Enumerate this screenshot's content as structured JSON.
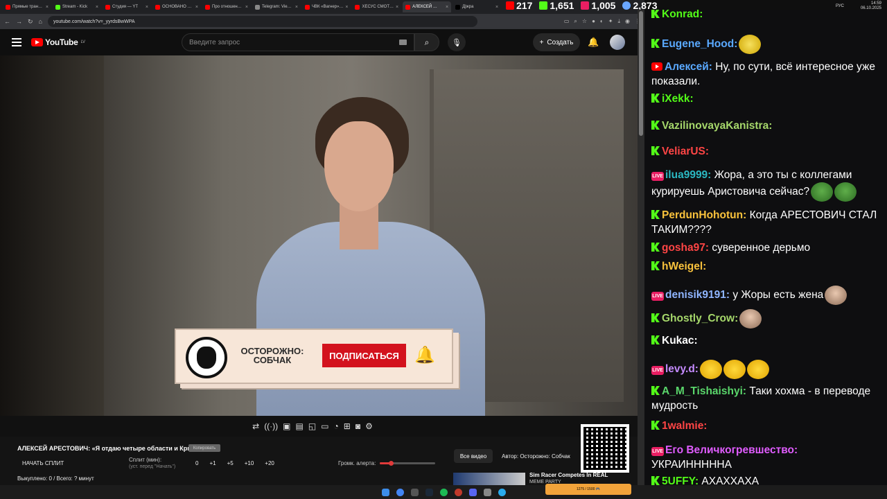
{
  "browser": {
    "tabs": [
      {
        "label": "Прямые тран…",
        "color": "#ff0000",
        "active": false
      },
      {
        "label": "Stream - Kick",
        "color": "#53fc18",
        "active": false
      },
      {
        "label": "Студия — YT",
        "color": "#ff0000",
        "active": false
      },
      {
        "label": "ОСНОВАНО …",
        "color": "#ff0000",
        "active": false
      },
      {
        "label": "Про отношен…",
        "color": "#ff0000",
        "active": false
      },
      {
        "label": "Telegram: Vie…",
        "color": "#888888",
        "active": false
      },
      {
        "label": "ЧВК «Вагнер»…",
        "color": "#ff0000",
        "active": false
      },
      {
        "label": "ХЕСУС СМОТ…",
        "color": "#ff0000",
        "active": false
      },
      {
        "label": "АЛЕКСЕЙ …",
        "color": "#ff0000",
        "active": true
      },
      {
        "label": "Д|жра",
        "color": "#000000",
        "active": false
      }
    ],
    "url": "youtube.com/watch?v=_yyrdsBwWPA"
  },
  "stream_stats": {
    "kick": "217",
    "kick_extra": "1,651",
    "live": "1,005",
    "viewers": "2,873"
  },
  "youtube": {
    "logo_text": "YouTube",
    "region": "LV",
    "search_placeholder": "Введите запрос",
    "create_label": "Создать"
  },
  "overlay": {
    "channel": "ОСТОРОЖНО: СОБЧАК",
    "subscribe": "ПОДПИСАТЬСЯ"
  },
  "tool": {
    "video_title": "АЛЕКСЕЙ АРЕСТОВИЧ: «Я отдаю четыре области и Крым»",
    "title_tag": "Копировать",
    "start_split": "НАЧАТЬ СПЛИТ",
    "split_label": "Сплит (мин):",
    "split_hint": "(уст. перед \"Начать\")",
    "split_values": [
      "0",
      "+1",
      "+5",
      "+10",
      "+20"
    ],
    "volume_label": "Громк. алерта:",
    "volume_level": 0.2,
    "status": "Выкуплено: 0 / Всего: ? минут",
    "all_videos": "Все видео",
    "author": "Автор: Осторожно: Собчак",
    "rec_title": "Sim Racer Competes In REAL",
    "rec_sub": "MEME PARTY"
  },
  "taskbar": {
    "lang": "РУС",
    "time": "14:59",
    "date": "06.10.2025",
    "progress": "1275 / 1500 🎮"
  },
  "chat": [
    {
      "platform": "kick",
      "name": "Konrad:",
      "color": "#53fc18",
      "text": "",
      "emotes": [
        "face"
      ]
    },
    {
      "platform": "kick",
      "name": "Eugene_Hood:",
      "color": "#5aa9ff",
      "text": "",
      "emotes": [
        "duck"
      ]
    },
    {
      "platform": "youtube",
      "name": "Алексей:",
      "color": "#5aa9ff",
      "text": "Ну, по сути, всё интересное уже показали.",
      "emotes": []
    },
    {
      "platform": "kick",
      "name": "iXekk:",
      "color": "#53fc18",
      "text": "",
      "emotes": [
        "face"
      ]
    },
    {
      "platform": "kick",
      "name": "VazilinovayaKanistra:",
      "color": "#a6d86b",
      "text": "",
      "emotes": [
        "face"
      ]
    },
    {
      "platform": "kick",
      "name": "VeliarUS:",
      "color": "#ff4545",
      "text": "",
      "emotes": [
        "face"
      ]
    },
    {
      "platform": "live",
      "name": "ilua9999:",
      "color": "#2bb8c2",
      "text": "Жора, а это ты с коллегами курируешь Аристовича сейчас?",
      "emotes": [
        "pepe",
        "pepe"
      ]
    },
    {
      "platform": "kick",
      "name": "PerdunHohotun:",
      "color": "#f9c23c",
      "text": "Когда АРЕСТОВИЧ СТАЛ ТАКИМ????",
      "emotes": []
    },
    {
      "platform": "kick",
      "name": "gosha97:",
      "color": "#ff4545",
      "text": "суверенное дерьмо",
      "emotes": []
    },
    {
      "platform": "kick",
      "name": "hWeigel:",
      "color": "#f9c23c",
      "text": "",
      "emotes": [
        "face"
      ]
    },
    {
      "platform": "live",
      "name": "denisik9191:",
      "color": "#8fb5ff",
      "text": "у Жоры есть жена",
      "emotes": [
        "bald"
      ]
    },
    {
      "platform": "kick",
      "name": "Ghostly_Crow:",
      "color": "#a6d86b",
      "text": "",
      "emotes": [
        "bald"
      ]
    },
    {
      "platform": "kick",
      "name": "Kukac:",
      "color": "#ffffff",
      "text": "",
      "emotes": [
        "face",
        "face",
        "face"
      ]
    },
    {
      "platform": "live",
      "name": "levy.d:",
      "color": "#c58bff",
      "text": "",
      "emotes": [
        "lol",
        "lol",
        "lol"
      ]
    },
    {
      "platform": "kick",
      "name": "A_M_Tishaishyi:",
      "color": "#5ad66b",
      "text": "Таки хохма - в переводе мудрость",
      "emotes": []
    },
    {
      "platform": "kick",
      "name": "1walmie:",
      "color": "#ff4545",
      "text": "",
      "emotes": [
        "face"
      ]
    },
    {
      "platform": "live",
      "name": "Его Величкогревшество:",
      "color": "#e05cff",
      "text": "УКРАИНННННА",
      "emotes": []
    },
    {
      "platform": "kick",
      "name": "5UFFY:",
      "color": "#53fc18",
      "text": "АХАХХАХА",
      "emotes": []
    }
  ]
}
